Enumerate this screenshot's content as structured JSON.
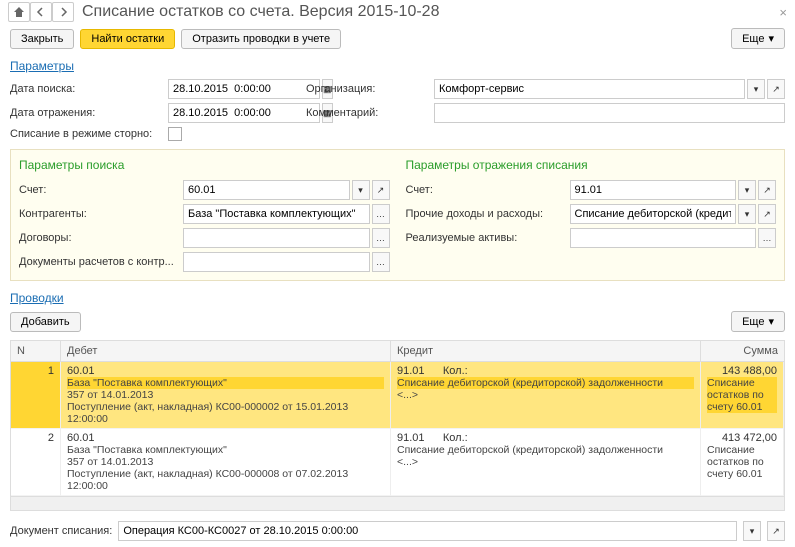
{
  "title": "Списание остатков со счета. Версия 2015-10-28",
  "buttons": {
    "close": "Закрыть",
    "find": "Найти остатки",
    "reflect": "Отразить проводки в учете",
    "more": "Еще",
    "add": "Добавить"
  },
  "sections": {
    "params": "Параметры",
    "entries": "Проводки"
  },
  "labels": {
    "search_date": "Дата поиска:",
    "org": "Организация:",
    "reflect_date": "Дата отражения:",
    "comment": "Комментарий:",
    "storno": "Списание в режиме сторно:",
    "search_params": "Параметры поиска",
    "writeoff_params": "Параметры отражения списания",
    "account": "Счет:",
    "counterparties": "Контрагенты:",
    "contracts": "Договоры:",
    "docs": "Документы расчетов с контр...",
    "other": "Прочие доходы и расходы:",
    "realiz": "Реализуемые активы:",
    "doc_writeoff": "Документ списания:"
  },
  "values": {
    "search_date": "28.10.2015  0:00:00",
    "org": "Комфорт-сервис",
    "reflect_date": "28.10.2015  0:00:00",
    "comment": "",
    "account_left": "60.01",
    "counterparties": "База \"Поставка комплектующих\"",
    "contracts": "",
    "docs": "",
    "account_right": "91.01",
    "other": "Списание дебиторской (кредиторской) задолженно",
    "realiz": "",
    "doc_writeoff": "Операция КС00-КС0027 от 28.10.2015 0:00:00"
  },
  "table": {
    "headers": {
      "n": "N",
      "debit": "Дебет",
      "credit": "Кредит",
      "sum": "Сумма"
    },
    "rows": [
      {
        "n": "1",
        "debit_acc": "60.01",
        "debit_l1": "База \"Поставка комплектующих\"",
        "debit_l2": "357 от 14.01.2013",
        "debit_l3": "Поступление (акт, накладная) КС00-000002 от 15.01.2013 12:00:00",
        "credit_acc": "91.01",
        "credit_qty": "Кол.:",
        "credit_l1": "Списание дебиторской (кредиторской) задолженности",
        "credit_l2": "<...>",
        "sum": "143 488,00",
        "sum_note": "Списание остатков по счету 60.01",
        "selected": true
      },
      {
        "n": "2",
        "debit_acc": "60.01",
        "debit_l1": "База \"Поставка комплектующих\"",
        "debit_l2": "357 от 14.01.2013",
        "debit_l3": "Поступление (акт, накладная) КС00-000008 от 07.02.2013 12:00:00",
        "credit_acc": "91.01",
        "credit_qty": "Кол.:",
        "credit_l1": "Списание дебиторской (кредиторской) задолженности",
        "credit_l2": "<...>",
        "sum": "413 472,00",
        "sum_note": "Списание остатков по счету 60.01",
        "selected": false
      }
    ]
  }
}
